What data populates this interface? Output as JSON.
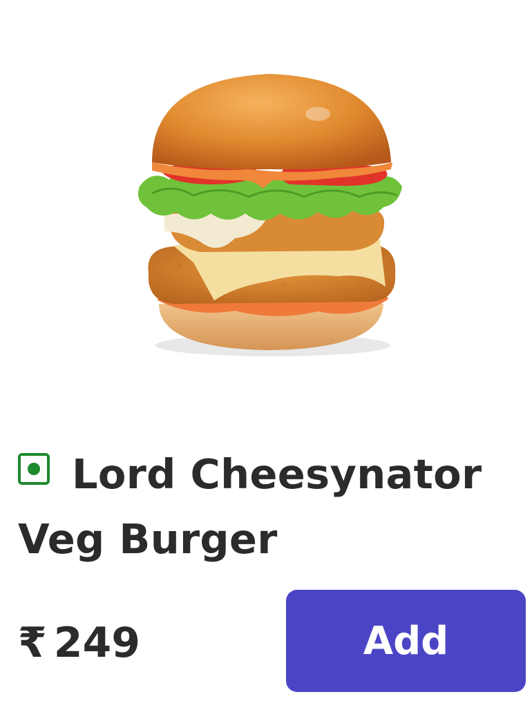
{
  "product": {
    "image_alt": "burger-image",
    "name": "Lord Cheesynator Veg Burger",
    "veg_indicator": "veg-icon",
    "currency": "₹",
    "price": "249"
  },
  "actions": {
    "add_label": "Add"
  },
  "colors": {
    "veg_green": "#1e8a2e",
    "button": "#4b45c6",
    "text": "#2b2b2b"
  }
}
